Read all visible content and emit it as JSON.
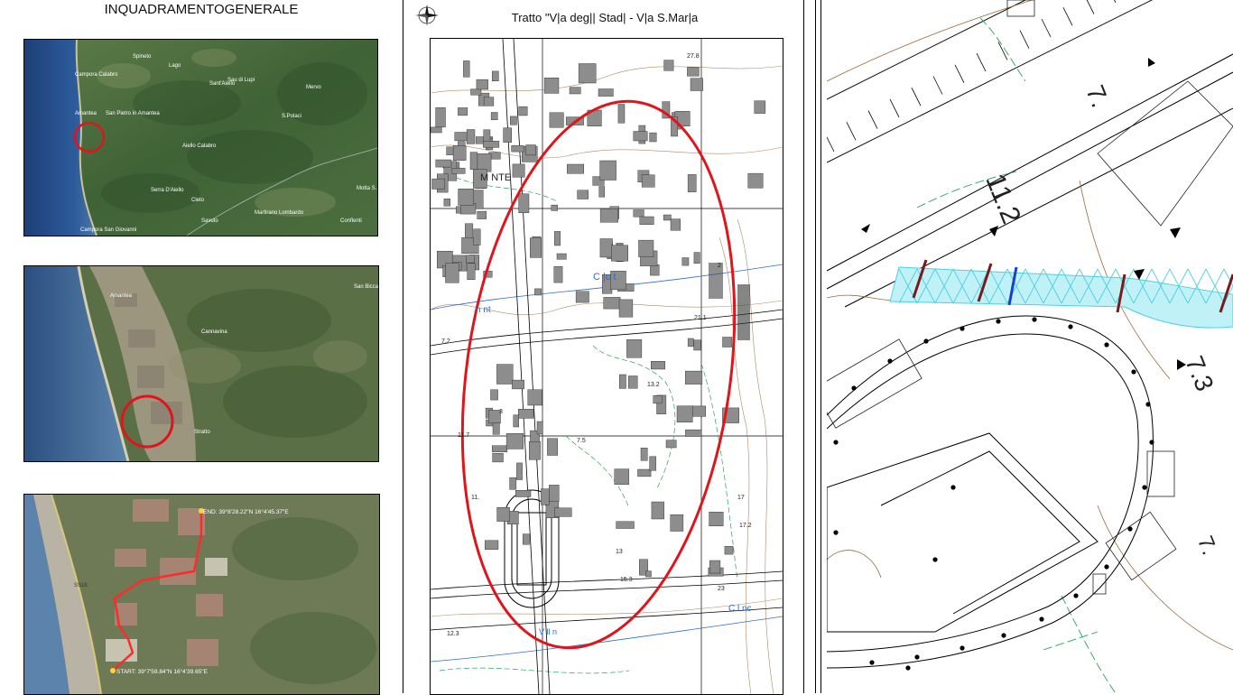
{
  "left_panel": {
    "title": "INQUADRAMENTOGENERALE",
    "map1_labels": [
      "Spineto",
      "Campora Calabro",
      "Lago",
      "Sant'Aiello",
      "Sau di Lupi",
      "Mervo",
      "Amantea",
      "San Pietro in Amantea",
      "Aiello Calabro",
      "S.Polaci",
      "Serra D'Aiello",
      "Cleto",
      "Savuto",
      "Martirano Lombardo",
      "Conflenti",
      "Motta S.",
      "Campora San Giovanni"
    ],
    "map2_labels": [
      "Amantea",
      "Cannavina",
      "San Bicca",
      "Stratto"
    ],
    "map3_labels": [
      "END: 39°8'28.22\"N  16°4'45.37\"E",
      "START: 39°7'59.84\"N  16°4'39.65\"E",
      "SS18"
    ]
  },
  "middle_panel": {
    "title": "Tratto \"V|a deg|| Stad| - V|a S.Mar|a",
    "map_labels": [
      "M NTE",
      "C  |c  t",
      "n  nt",
      "C  l  nc",
      "V  ll  n",
      "21.1",
      "7.2",
      "13.2",
      "7.5",
      "11.7",
      "11.",
      "13",
      "15.3",
      "17",
      "17.2",
      "27.8",
      "23",
      "12.3",
      "3",
      "2"
    ]
  },
  "right_panel": {
    "map_labels": [
      "11.2",
      "7.",
      "7.3",
      "7."
    ]
  },
  "colors": {
    "highlight_red": "#e0151b",
    "route_red": "#ff2a2a",
    "sea_blue": "#2a4f86",
    "bridge_cyan": "#4fd0e0",
    "contour_brown": "#9a6a3a",
    "contour_green": "#2aa35a"
  }
}
